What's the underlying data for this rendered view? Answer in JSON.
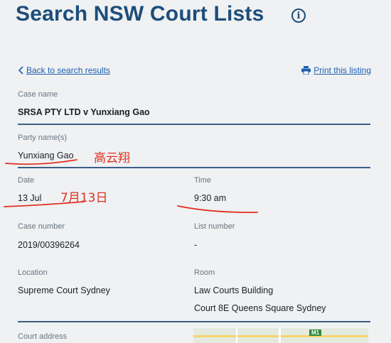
{
  "header": {
    "title": "Search NSW Court Lists",
    "info_icon": "info-icon"
  },
  "nav": {
    "back_label": "Back to search results",
    "print_label": "Print this listing"
  },
  "case": {
    "case_name_label": "Case name",
    "case_name": "SRSA PTY LTD v Yunxiang Gao",
    "party_label": "Party name(s)",
    "party": "Yunxiang Gao",
    "date_label": "Date",
    "date": "13 Jul",
    "time_label": "Time",
    "time": "9:30 am",
    "case_number_label": "Case number",
    "case_number": "2019/00396264",
    "list_number_label": "List number",
    "list_number": "-",
    "location_label": "Location",
    "location": "Supreme Court Sydney",
    "room_label": "Room",
    "room_line1": "Law Courts Building",
    "room_line2": "Court 8E Queens Square Sydney",
    "court_address_label": "Court address"
  },
  "annotations": {
    "party_chinese": "高云翔",
    "date_chinese": "7月13日",
    "ink_color": "#e0301e"
  },
  "map": {
    "road_badge": "M1"
  },
  "colors": {
    "accent": "#1d4d7a",
    "link": "#1f5fb0",
    "divider": "#3b5f86",
    "background": "#eff1f3"
  }
}
